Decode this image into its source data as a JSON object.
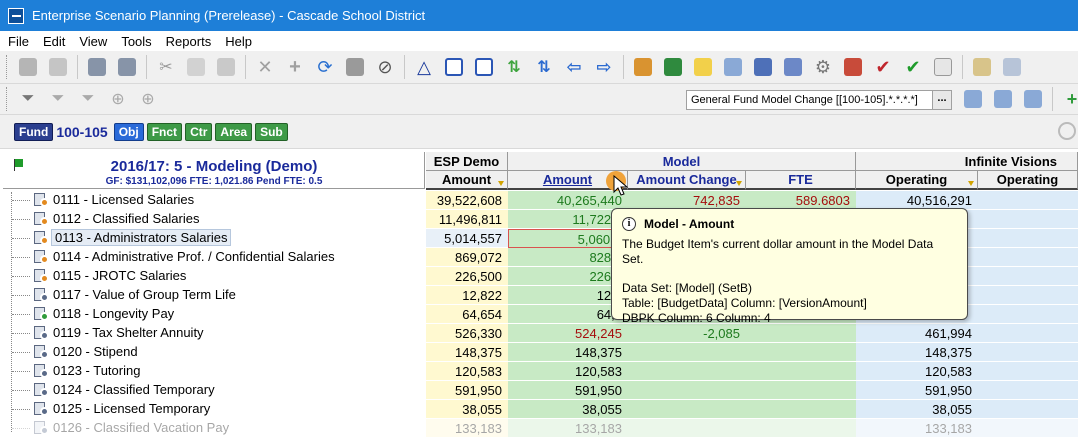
{
  "window": {
    "title": "Enterprise Scenario Planning (Prerelease) - Cascade School District"
  },
  "menu": [
    "File",
    "Edit",
    "View",
    "Tools",
    "Reports",
    "Help"
  ],
  "toolbar": {
    "model_combo": "General Fund Model Change [[100-105].*.*.*.*]",
    "combo_button": "...",
    "fund_label": "Fund",
    "fund_value": "100-105",
    "tags": [
      "Obj",
      "Fnct",
      "Ctr",
      "Area",
      "Sub"
    ]
  },
  "grid": {
    "corner_title": "2016/17: 5 - Modeling  (Demo)",
    "corner_subtitle": "GF: $131,102,096  FTE: 1,021.86  Pend FTE: 0.5",
    "group_headers": [
      "ESP Demo",
      "Model",
      "Infinite Visions"
    ],
    "columns": [
      "Amount",
      "Amount",
      "Amount Change",
      "FTE",
      "Operating",
      "Operating"
    ],
    "rows": [
      {
        "label": "0111 - Licensed Salaries",
        "esp": "39,522,608",
        "amount": "40,265,440",
        "change": "742,835",
        "fte": "589.6803",
        "op1": "40,516,291",
        "op2": ""
      },
      {
        "label": "0112 - Classified Salaries",
        "esp": "11,496,811",
        "amount": "11,722,5",
        "change": "",
        "fte": "",
        "op1": "",
        "op2": ""
      },
      {
        "label": "0113 - Administrators Salaries",
        "esp": "5,014,557",
        "amount": "5,060,1",
        "change": "",
        "fte": "",
        "op1": "",
        "op2": ""
      },
      {
        "label": "0114 - Administrative Prof. / Confidential Salaries",
        "esp": "869,072",
        "amount": "828,6",
        "change": "",
        "fte": "",
        "op1": "",
        "op2": ""
      },
      {
        "label": "0115 - JROTC Salaries",
        "esp": "226,500",
        "amount": "226,5",
        "change": "",
        "fte": "",
        "op1": "",
        "op2": ""
      },
      {
        "label": "0117 - Value of Group Term Life",
        "esp": "12,822",
        "amount": "12,8",
        "change": "",
        "fte": "",
        "op1": "",
        "op2": ""
      },
      {
        "label": "0118 - Longevity Pay",
        "esp": "64,654",
        "amount": "64,6",
        "change": "",
        "fte": "",
        "op1": "",
        "op2": ""
      },
      {
        "label": "0119 - Tax Shelter Annuity",
        "esp": "526,330",
        "amount": "524,245",
        "change": "-2,085",
        "fte": "",
        "op1": "461,994",
        "op2": ""
      },
      {
        "label": "0120 - Stipend",
        "esp": "148,375",
        "amount": "148,375",
        "change": "",
        "fte": "",
        "op1": "148,375",
        "op2": ""
      },
      {
        "label": "0123 - Tutoring",
        "esp": "120,583",
        "amount": "120,583",
        "change": "",
        "fte": "",
        "op1": "120,583",
        "op2": ""
      },
      {
        "label": "0124 - Classified Temporary",
        "esp": "591,950",
        "amount": "591,950",
        "change": "",
        "fte": "",
        "op1": "591,950",
        "op2": ""
      },
      {
        "label": "0125 - Licensed Temporary",
        "esp": "38,055",
        "amount": "38,055",
        "change": "",
        "fte": "",
        "op1": "38,055",
        "op2": ""
      },
      {
        "label": "0126 - Classified Vacation Pay",
        "esp": "133,183",
        "amount": "133,183",
        "change": "",
        "fte": "",
        "op1": "133,183",
        "op2": ""
      }
    ]
  },
  "tooltip": {
    "title": "Model - Amount",
    "description": "The Budget Item's current dollar amount in the Model Data Set.",
    "dataset": "Data Set: [Model]  (SetB)",
    "table": "Table: [BudgetData]  Column: [VersionAmount]",
    "dbpk": "DBPK Column: 6  Column: 4"
  },
  "colors": {
    "titlebar": "#1e7fd8",
    "model_header": "#1a2a9b",
    "model_cells": "#c8eac5",
    "esp_cells": "#fff9d0",
    "iv_cells": "#dcebf8"
  }
}
